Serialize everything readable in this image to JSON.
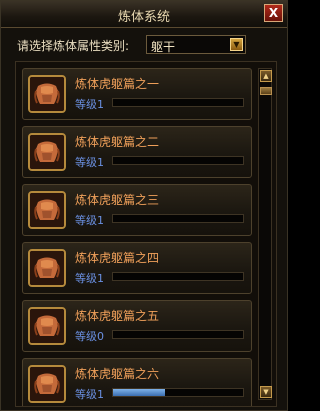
{
  "window": {
    "title": "炼体系统",
    "close_glyph": "X"
  },
  "filter": {
    "label": "请选择炼体属性类别:",
    "selected": "躯干",
    "arrow_glyph": "▼"
  },
  "items": [
    {
      "name": "炼体虎躯篇之一",
      "level": "等级1",
      "progress": 0
    },
    {
      "name": "炼体虎躯篇之二",
      "level": "等级1",
      "progress": 0
    },
    {
      "name": "炼体虎躯篇之三",
      "level": "等级1",
      "progress": 0
    },
    {
      "name": "炼体虎躯篇之四",
      "level": "等级1",
      "progress": 0
    },
    {
      "name": "炼体虎躯篇之五",
      "level": "等级0",
      "progress": 0
    },
    {
      "name": "炼体虎躯篇之六",
      "level": "等级1",
      "progress": 0.4
    }
  ],
  "scroll": {
    "up_glyph": "▲",
    "down_glyph": "▼"
  },
  "colors": {
    "item_name": "#f0a05a",
    "item_level": "#6a8fe0",
    "progress_fill": "#5b8fd0"
  },
  "icons": {
    "item_icon": "armor-torso-icon"
  }
}
